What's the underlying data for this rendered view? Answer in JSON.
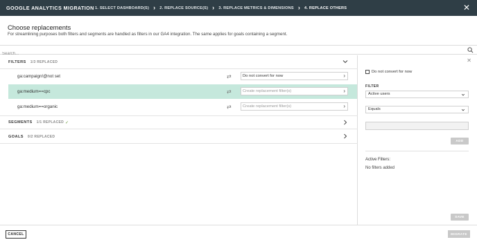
{
  "header": {
    "title": "GOOGLE ANALYTICS MIGRATION",
    "steps": [
      {
        "label": "1. SELECT DASHBOARD(S)"
      },
      {
        "label": "2. REPLACE SOURCE(S)"
      },
      {
        "label": "3. REPLACE METRICS & DIMENSIONS"
      },
      {
        "label": "4. REPLACE OTHERS"
      }
    ],
    "close_icon": "close-icon"
  },
  "page": {
    "title": "Choose replacements",
    "subtitle": "For streamlining purposes both filters and segments are handled as filters in our GA4 integration. The same applies for goals containing a segment."
  },
  "search": {
    "placeholder": "Search..."
  },
  "sections": {
    "filters": {
      "title": "FILTERS",
      "count": "1/3 REPLACED",
      "rows": [
        {
          "label": "ga:campaign!@not set",
          "replacement": "Do not convert for now",
          "is_placeholder": false
        },
        {
          "label": "ga:medium==cpc",
          "replacement": "Create replacement filter(s)",
          "is_placeholder": true
        },
        {
          "label": "ga:medium==organic",
          "replacement": "Create replacement filter(s)",
          "is_placeholder": true
        }
      ]
    },
    "segments": {
      "title": "SEGMENTS",
      "count": "1/1 REPLACED"
    },
    "goals": {
      "title": "GOALS",
      "count": "0/2 REPLACED"
    }
  },
  "side_panel": {
    "do_not_convert": "Do not convert for now",
    "filter_label": "FILTER",
    "field_value": "Active users",
    "operator_value": "Equals",
    "add_label": "ADD",
    "active_filters_label": "Active Filters:",
    "empty_label": "No filters added",
    "save_label": "SAVE"
  },
  "footer": {
    "cancel_label": "CANCEL",
    "migrate_label": "MIGRATE"
  },
  "colors": {
    "topbar": "#2f3e46",
    "selected_row": "#c5e8dc",
    "success": "#6a9a3e",
    "disabled_button": "#c9c9c9"
  }
}
